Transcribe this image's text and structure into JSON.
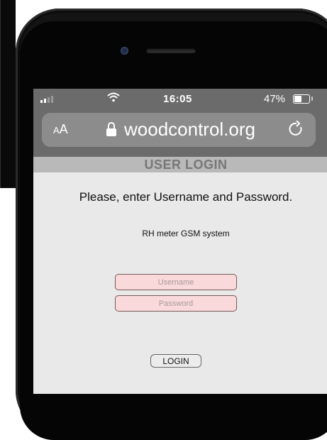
{
  "status_bar": {
    "time": "16:05",
    "battery_percent": "47%",
    "battery_level": 0.47
  },
  "browser": {
    "text_size_label_small": "A",
    "text_size_label_large": "A",
    "url": "woodcontrol.org"
  },
  "page": {
    "header": "USER LOGIN",
    "prompt": "Please, enter Username and Password.",
    "subtitle": "RH meter GSM system",
    "username_placeholder": "Username",
    "password_placeholder": "Password",
    "login_label": "LOGIN"
  },
  "colors": {
    "field_bg": "#f9d9d9",
    "header_bar": "#b9b9b9",
    "browser_chrome": "#6b6b6b"
  }
}
